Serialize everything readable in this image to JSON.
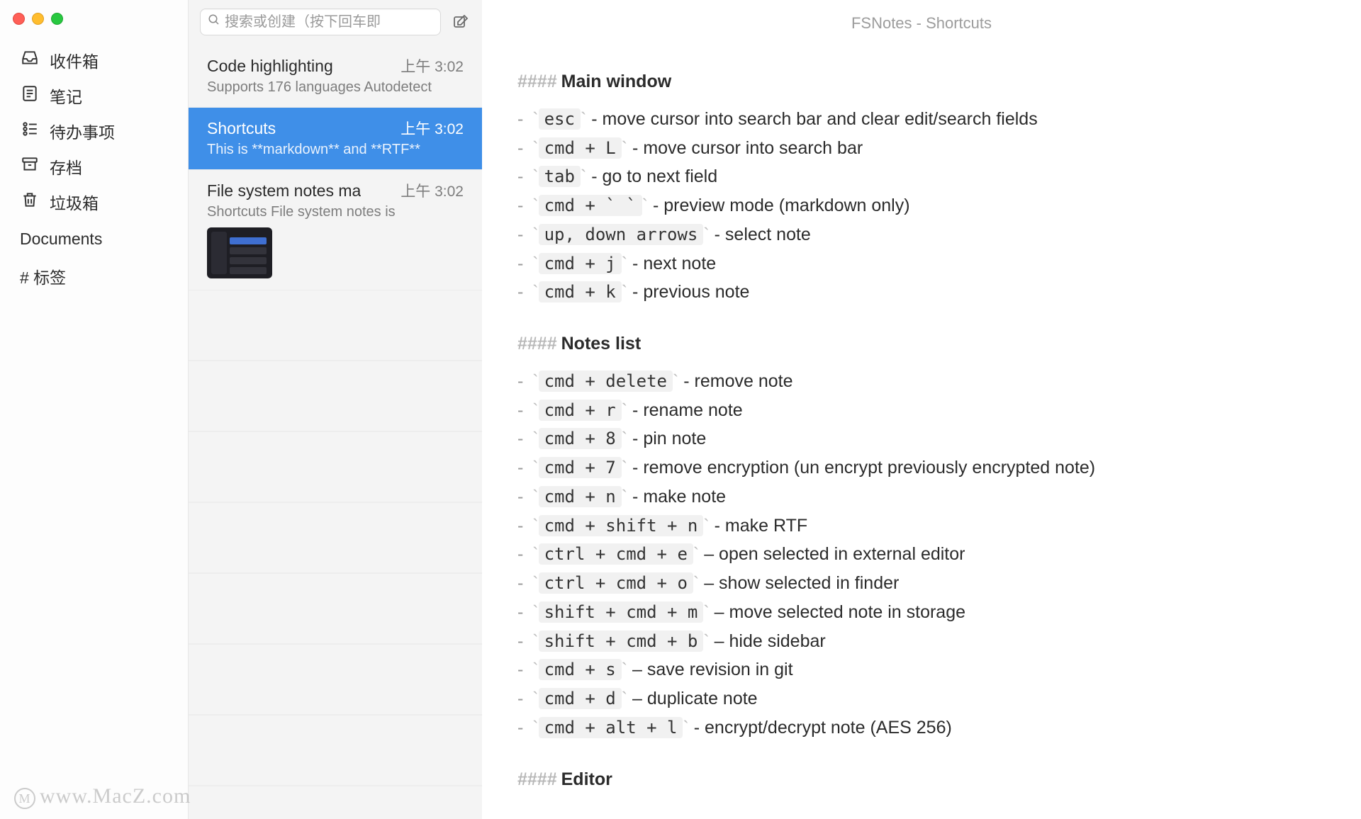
{
  "window_title": "FSNotes - Shortcuts",
  "search": {
    "placeholder": "搜索或创建（按下回车即"
  },
  "sidebar": {
    "items": [
      {
        "icon": "inbox-icon",
        "glyph": "📥",
        "label": "收件箱"
      },
      {
        "icon": "notes-icon",
        "glyph": "🗒",
        "label": "笔记"
      },
      {
        "icon": "todo-icon",
        "glyph": "☑",
        "label": "待办事项"
      },
      {
        "icon": "archive-icon",
        "glyph": "🗄",
        "label": "存档"
      },
      {
        "icon": "trash-icon",
        "glyph": "🗑",
        "label": "垃圾箱"
      }
    ],
    "documents_label": "Documents",
    "tag_label": "# 标签"
  },
  "notes": [
    {
      "title": "Code highlighting",
      "time": "上午 3:02",
      "subtitle": "Supports 176 languages Autodetect",
      "selected": false,
      "thumb": false
    },
    {
      "title": "Shortcuts",
      "time": "上午 3:02",
      "subtitle": "This is **markdown** and **RTF**",
      "selected": true,
      "thumb": false
    },
    {
      "title": "File system notes ma",
      "time": "上午 3:02",
      "subtitle": "Shortcuts File system notes is",
      "selected": false,
      "thumb": true
    }
  ],
  "document": {
    "sections": [
      {
        "heading": "Main window",
        "lines": [
          {
            "code": "esc",
            "text": " - move cursor into search bar and clear edit/search fields"
          },
          {
            "code": "cmd + L",
            "text": " - move cursor into search bar"
          },
          {
            "code": "tab",
            "text": " - go to next field"
          },
          {
            "code": "cmd + ` `",
            "text": " - preview mode (markdown only)"
          },
          {
            "code": "up, down arrows",
            "text": " - select note"
          },
          {
            "code": "cmd + j",
            "text": " - next note"
          },
          {
            "code": "cmd + k",
            "text": " - previous note"
          }
        ]
      },
      {
        "heading": "Notes list",
        "lines": [
          {
            "code": "cmd + delete",
            "text": " - remove note"
          },
          {
            "code": "cmd + r",
            "text": " - rename note"
          },
          {
            "code": "cmd + 8",
            "text": " - pin note"
          },
          {
            "code": "cmd + 7",
            "text": " - remove encryption (un encrypt previously encrypted note)"
          },
          {
            "code": "cmd + n",
            "text": " - make note"
          },
          {
            "code": "cmd + shift + n",
            "text": " - make RTF"
          },
          {
            "code": "ctrl + cmd + e",
            "text": " – open selected in external editor"
          },
          {
            "code": "ctrl + cmd + o",
            "text": " – show selected in finder"
          },
          {
            "code": "shift + cmd + m",
            "text": " – move selected note in storage"
          },
          {
            "code": "shift + cmd + b",
            "text": " – hide sidebar"
          },
          {
            "code": "cmd + s",
            "text": " – save revision in git"
          },
          {
            "code": "cmd + d",
            "text": " – duplicate note"
          },
          {
            "code": "cmd + alt + l",
            "text": " - encrypt/decrypt note (AES 256)"
          }
        ]
      },
      {
        "heading": "Editor",
        "lines": []
      }
    ]
  },
  "watermark": "www.MacZ.com"
}
